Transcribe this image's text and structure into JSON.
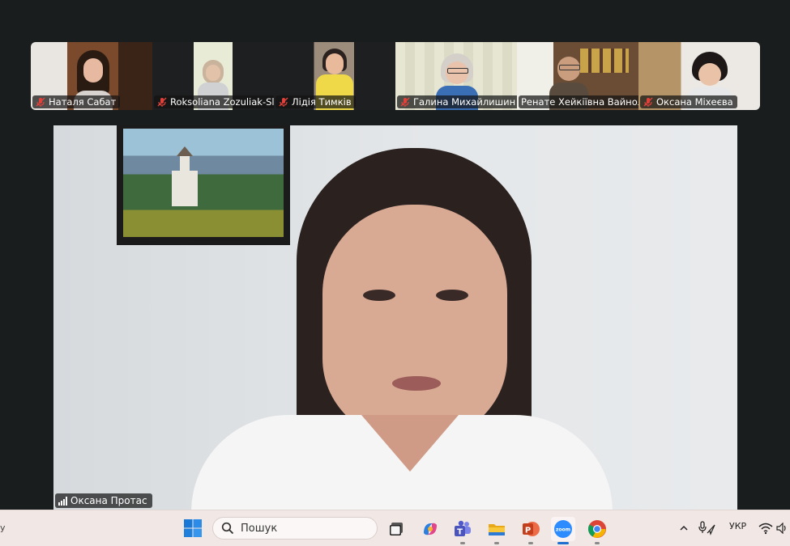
{
  "gallery": {
    "participants": [
      {
        "name": "Наталя Сабат",
        "muted": true
      },
      {
        "name": "Roksoliana Zozuliak-Sl...",
        "muted": true
      },
      {
        "name": "Лідія Тимків",
        "muted": true
      },
      {
        "name": "Галина Михайлишин",
        "muted": true
      },
      {
        "name": "Ренате Хейкіївна Вайнола",
        "muted": false
      },
      {
        "name": "Оксана Міхеєва",
        "muted": true
      }
    ]
  },
  "speaker": {
    "name": "Оксана Протас"
  },
  "taskbar": {
    "left_text": "у",
    "search": {
      "placeholder": "Пошук"
    },
    "apps": [
      "windows-start",
      "file-explorer-virtual-desktops",
      "copilot",
      "teams",
      "file-explorer",
      "powerpoint",
      "zoom",
      "chrome"
    ],
    "tray": {
      "language": "УКР"
    }
  },
  "colors": {
    "background": "#1a1d1e",
    "taskbar": "#f1e7e4",
    "muted_red": "#e0413a",
    "zoom_blue": "#2d8cff"
  }
}
